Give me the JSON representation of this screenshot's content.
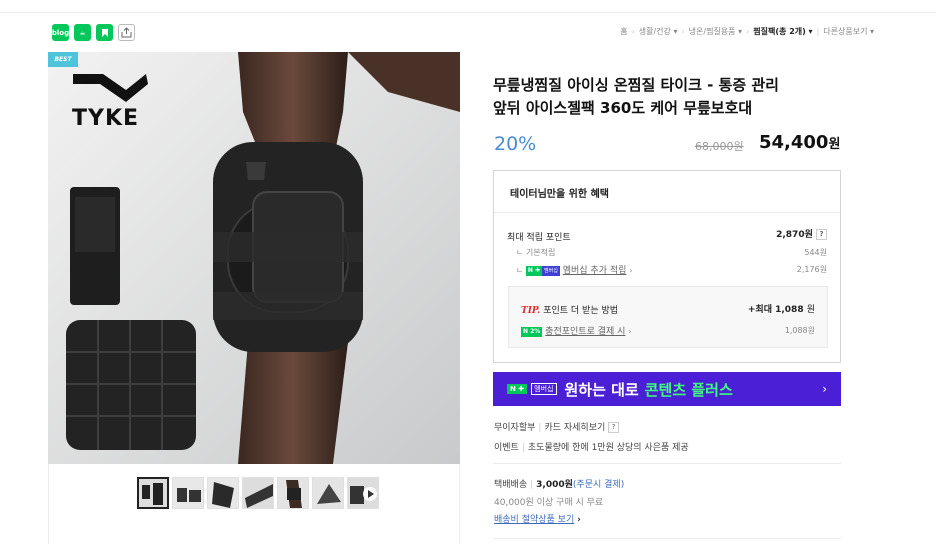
{
  "share": {
    "blog": "blog",
    "cafe": "☕",
    "keep": "▶",
    "share": "⇪"
  },
  "breadcrumb": {
    "items": [
      "홈",
      "생활/건강 ▾",
      "냉온/찜질용품 ▾"
    ],
    "current": "찜질팩",
    "current_count": "(총 2개) ▾",
    "more": "다른상품보기 ▾"
  },
  "gallery": {
    "badge": "BEST",
    "brand": "TYKE",
    "thumb_count": 7
  },
  "product": {
    "title_line1": "무릎냉찜질 아이싱 온찜질 타이크 - 통증 관리",
    "title_line2": "앞뒤 아이스젤팩 360도 케어 무릎보호대",
    "discount": "20%",
    "original_price": "68,000원",
    "sale_price": "54,400",
    "sale_unit": "원"
  },
  "benefit": {
    "heading": "테이터님만을 위한 혜택",
    "max_points_label": "최대 적립 포인트",
    "max_points_value": "2,870원",
    "basic_label": "기본적립",
    "basic_value": "544원",
    "member_label": "멤버십 추가 적립",
    "member_value": "2,176원",
    "n_badge": "N ✚",
    "member_badge": "멤버십",
    "tip_label": "TIP.",
    "tip_text": "포인트 더 받는 방법",
    "tip_value": "+최대 1,088",
    "tip_unit": "원",
    "charge_badge": "N 2%",
    "charge_label": "충전포인트로 결제 시",
    "charge_value": "1,088원"
  },
  "banner": {
    "n": "N ✚",
    "member": "멤버십",
    "text1": "원하는 대로",
    "text2": "콘텐츠 플러스",
    "chev": "›"
  },
  "payment": {
    "installment": "무이자할부",
    "card": "카드 자세히보기",
    "event_label": "이벤트",
    "event_text": "초도물량에 한에 1만원 상당의 사은품 제공"
  },
  "shipping": {
    "label": "택배배송",
    "fee": "3,000원",
    "fee_note": "(주문시 결제)",
    "free": "40,000원 이상 구매 시 무료",
    "saving_link": "배송비 절약상품 보기"
  },
  "colors": {
    "accent": "#03c75a",
    "discount": "#4a8bd4",
    "banner": "#4b1fd6"
  }
}
